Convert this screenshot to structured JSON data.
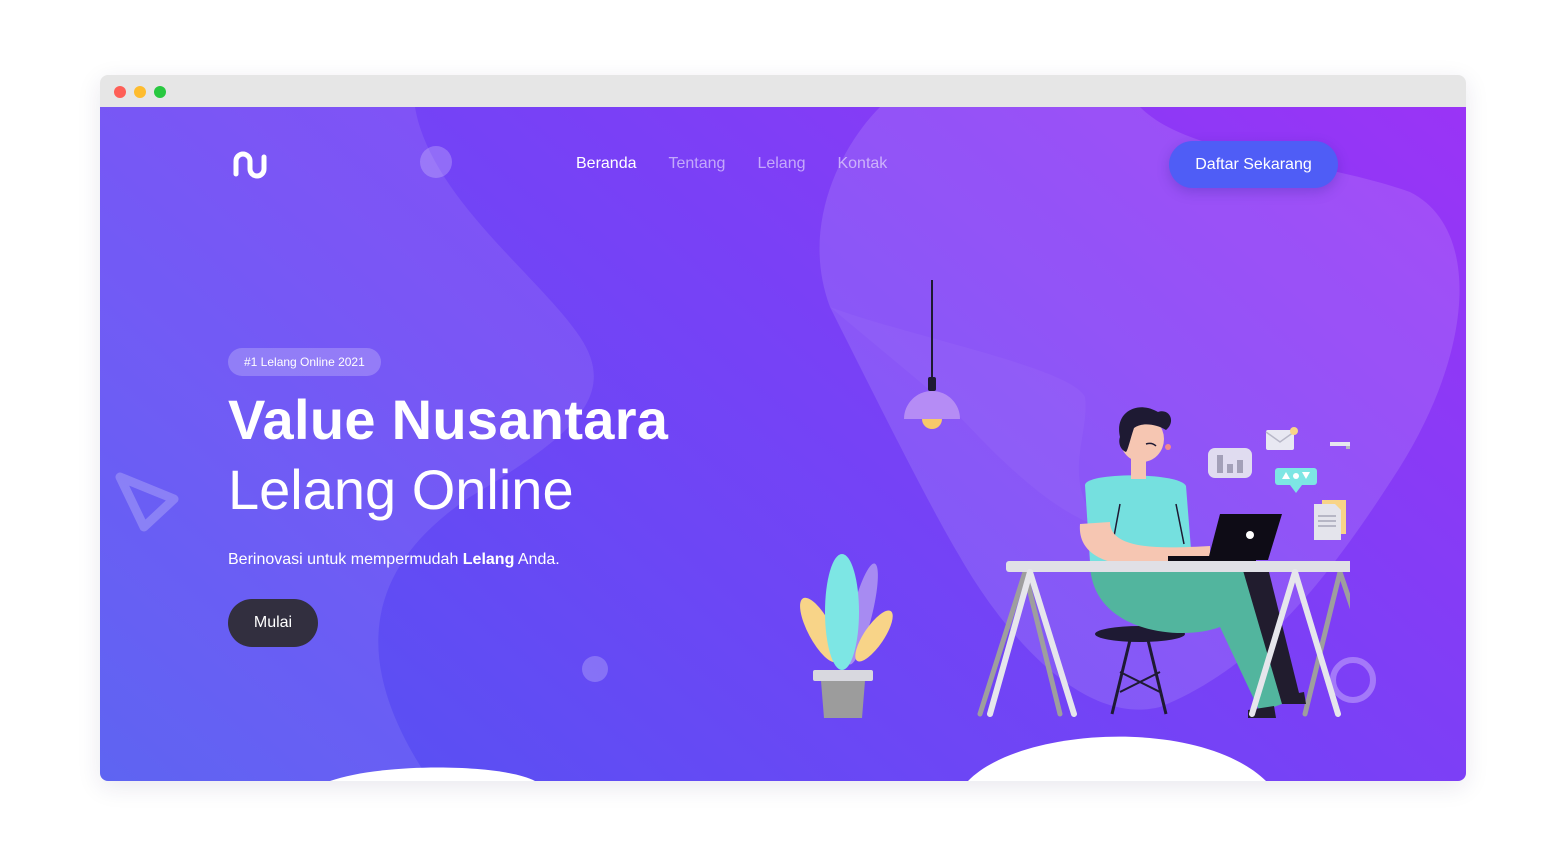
{
  "window": {
    "controls": [
      "close",
      "minimize",
      "maximize"
    ]
  },
  "header": {
    "logo_icon": "brand-logo-icon",
    "nav": [
      {
        "label": "Beranda",
        "active": true
      },
      {
        "label": "Tentang",
        "active": false
      },
      {
        "label": "Lelang",
        "active": false
      },
      {
        "label": "Kontak",
        "active": false
      }
    ],
    "cta_label": "Daftar Sekarang"
  },
  "hero": {
    "badge": "#1 Lelang Online 2021",
    "title_bold": "Value Nusantara",
    "title_light": "Lelang Online",
    "tagline_prefix": "Berinovasi untuk mempermudah ",
    "tagline_bold": "Lelang",
    "tagline_suffix": " Anda.",
    "button_label": "Mulai"
  },
  "colors": {
    "gradient_start": "#4f55f1",
    "gradient_end": "#9a34f6",
    "cta_bg": "#4f5df6",
    "button_dark": "#322f3f"
  }
}
